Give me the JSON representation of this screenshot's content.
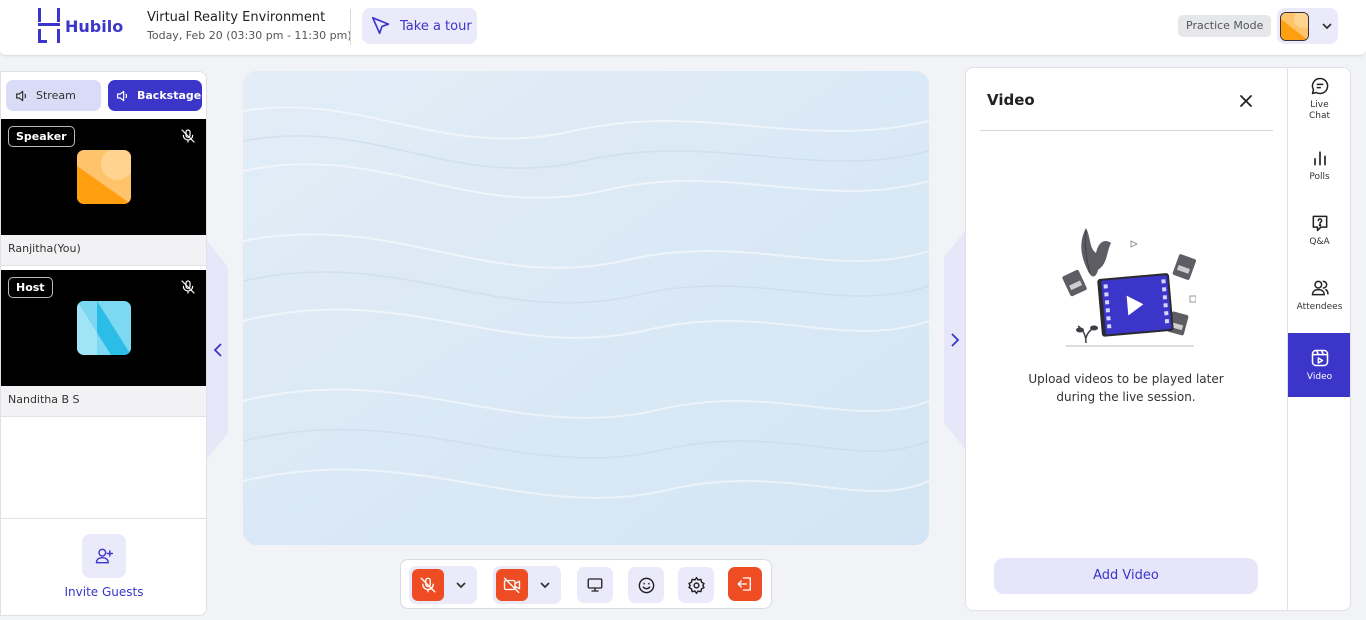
{
  "header": {
    "logo_text": "Hubilo",
    "event_title": "Virtual Reality Environment",
    "event_time": "Today, Feb 20 (03:30 pm - 11:30 pm)",
    "tour_label": "Take a tour",
    "practice_mode": "Practice Mode"
  },
  "left": {
    "stream_label": "Stream",
    "backstage_label": "Backstage",
    "participants": [
      {
        "badge": "Speaker",
        "name": "Ranjitha(You)"
      },
      {
        "badge": "Host",
        "name": "Nanditha B S"
      }
    ],
    "invite_label": "Invite Guests"
  },
  "right": {
    "title": "Video",
    "upload_line1": "Upload videos to be played later",
    "upload_line2": "during the live session.",
    "add_button": "Add Video",
    "rail": [
      {
        "line1": "Live",
        "line2": "Chat",
        "icon": "chat-icon"
      },
      {
        "line1": "Polls",
        "line2": "",
        "icon": "polls-icon"
      },
      {
        "line1": "Q&A",
        "line2": "",
        "icon": "question-icon"
      },
      {
        "line1": "Attendees",
        "line2": "",
        "icon": "attendees-icon"
      },
      {
        "line1": "Video",
        "line2": "",
        "icon": "video-icon",
        "active": true
      }
    ]
  },
  "colors": {
    "brand": "#3b35c9",
    "danger": "#ee4d24",
    "tint": "#ebeafb"
  }
}
